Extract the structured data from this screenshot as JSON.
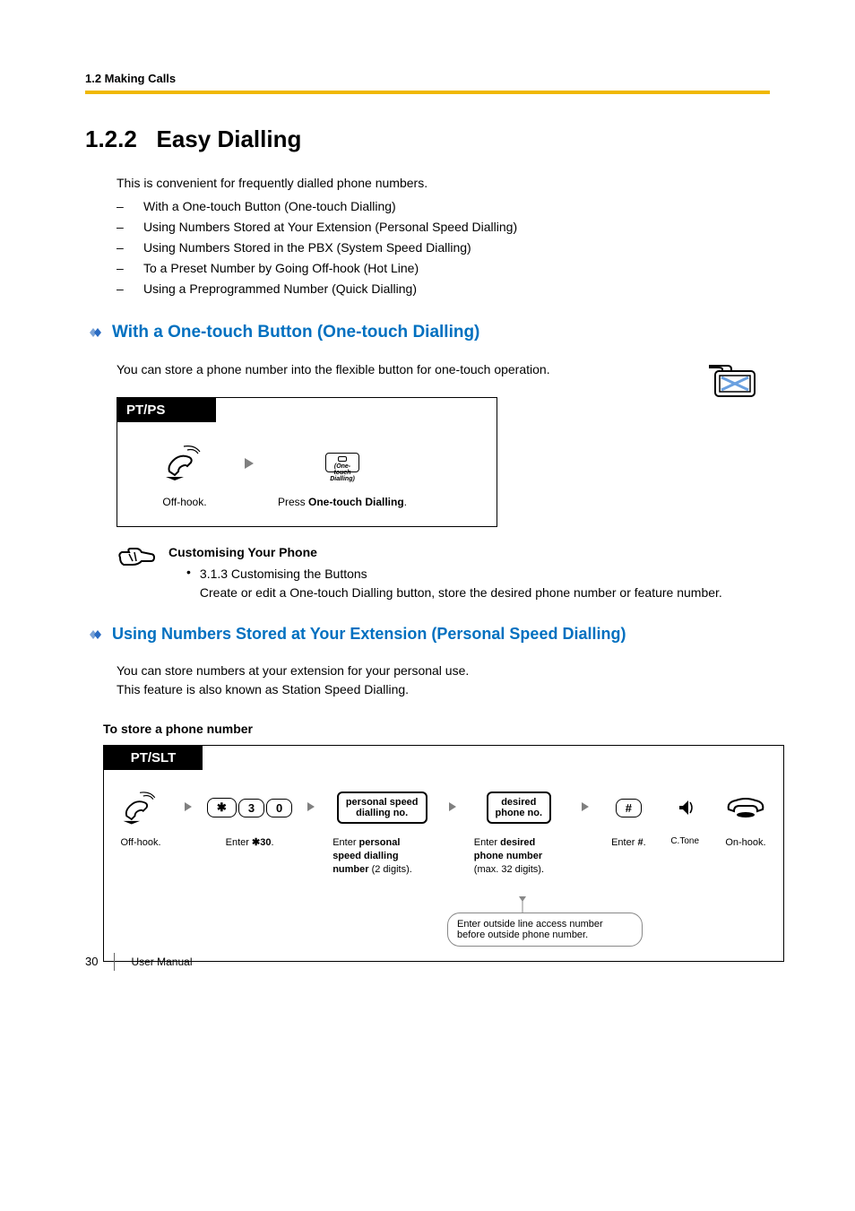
{
  "header": {
    "breadcrumb": "1.2 Making Calls"
  },
  "title": {
    "number": "1.2.2",
    "text": "Easy Dialling"
  },
  "intro": "This is convenient for frequently dialled phone numbers.",
  "bullets": [
    "With a One-touch Button (One-touch Dialling)",
    "Using Numbers Stored at Your Extension (Personal Speed Dialling)",
    "Using Numbers Stored in the PBX (System Speed Dialling)",
    "To a Preset Number by Going Off-hook (Hot Line)",
    "Using a Preprogrammed Number (Quick Dialling)"
  ],
  "section1": {
    "heading": "With a One-touch Button (One-touch Dialling)",
    "desc": "You can store a phone number into the flexible button for one-touch operation.",
    "diagram": {
      "header": "PT/PS",
      "step1": "Off-hook.",
      "btn_label_line1": "(One-touch",
      "btn_label_line2": "Dialling)",
      "step2_prefix": "Press ",
      "step2_bold": "One-touch Dialling",
      "step2_suffix": "."
    },
    "note": {
      "title": "Customising Your Phone",
      "item_ref": "3.1.3 Customising the Buttons",
      "item_text": "Create or edit a One-touch Dialling button, store the desired phone number or feature number."
    }
  },
  "section2": {
    "heading": "Using Numbers Stored at Your Extension (Personal Speed Dialling)",
    "desc_line1": "You can store numbers at your extension for your personal use.",
    "desc_line2": "This feature is also known as Station Speed Dialling.",
    "store_title": "To store a phone number",
    "diagram": {
      "header": "PT/SLT",
      "off_hook": "Off-hook.",
      "keys": {
        "star": "✱",
        "three": "3",
        "zero": "0"
      },
      "enter_30_prefix": "Enter ",
      "enter_30_bold": "✱30",
      "enter_30_suffix": ".",
      "box1_l1": "personal speed",
      "box1_l2": "dialling no.",
      "enter_psd_prefix": "Enter ",
      "enter_psd_bold": "personal speed dialling number",
      "enter_psd_suffix": " (2 digits).",
      "box2_l1": "desired",
      "box2_l2": "phone no.",
      "enter_dpn_prefix": "Enter ",
      "enter_dpn_bold": "desired phone number",
      "enter_dpn_suffix": " (max. 32 digits).",
      "hash": "#",
      "enter_hash_prefix": "Enter ",
      "enter_hash_bold": "#",
      "enter_hash_suffix": ".",
      "ctone": "C.Tone",
      "on_hook": "On-hook.",
      "hint": "Enter outside line access number before outside phone number."
    }
  },
  "footer": {
    "page": "30",
    "label": "User Manual"
  }
}
